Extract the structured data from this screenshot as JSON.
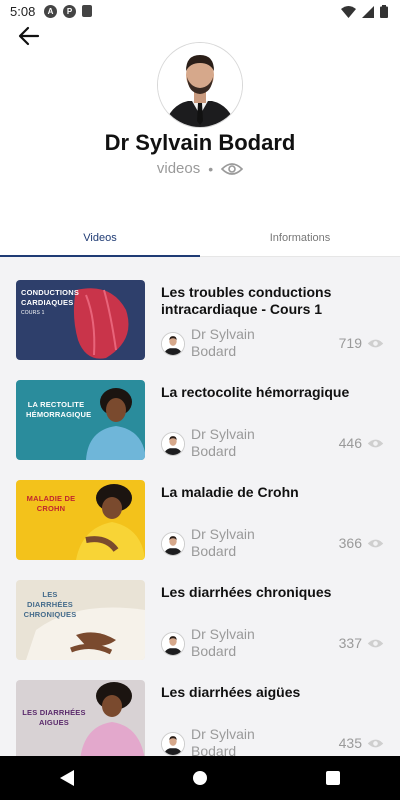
{
  "status_bar": {
    "time": "5:08"
  },
  "profile": {
    "name": "Dr Sylvain  Bodard",
    "subtitle": "videos",
    "separator": "•"
  },
  "tabs": [
    {
      "label": "Videos",
      "active": true
    },
    {
      "label": "Informations",
      "active": false
    }
  ],
  "videos": [
    {
      "title": "Les troubles conductions intracardiaque - Cours 1",
      "author": "Dr Sylvain Bodard",
      "views": "719",
      "thumb_label": "CONDUCTIONS CARDIAQUES",
      "thumb_sub": "COURS 1"
    },
    {
      "title": "La rectocolite hémorragique",
      "author": "Dr Sylvain Bodard",
      "views": "446",
      "thumb_label": "LA RECTOLITE HÉMORRAGIQUE"
    },
    {
      "title": "La maladie de Crohn",
      "author": "Dr Sylvain Bodard",
      "views": "366",
      "thumb_label": "MALADIE DE CROHN"
    },
    {
      "title": "Les diarrhées chroniques",
      "author": "Dr Sylvain Bodard",
      "views": "337",
      "thumb_label": "LES DIARRHÉES CHRONIQUES"
    },
    {
      "title": "Les diarrhées aigües",
      "author": "Dr Sylvain Bodard",
      "views": "435",
      "thumb_label": "LES DIARRHÉES AIGUES"
    }
  ],
  "colors": {
    "accent": "#1f3b74",
    "muted": "#9a9a9a",
    "background": "#f3f3f5"
  }
}
